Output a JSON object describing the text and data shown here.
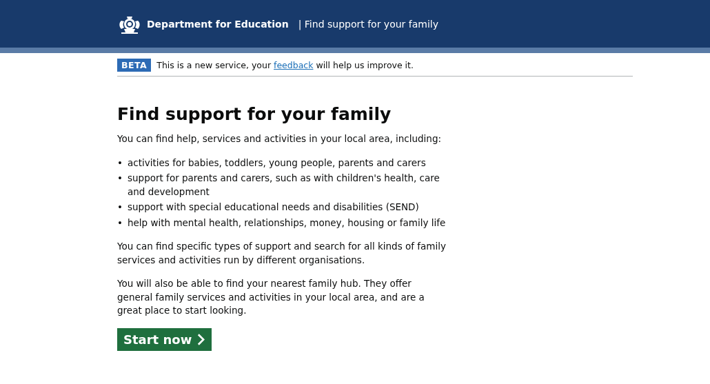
{
  "header": {
    "organisation": "Department for Education",
    "service": "| Find support for your family"
  },
  "phase_banner": {
    "tag": "BETA",
    "text_before": "This is a new service, your",
    "link": "feedback",
    "text_after": "will help us improve it."
  },
  "heading": "Find support for your family",
  "intro": "You can find help, services and activities in your local area, including:",
  "bullets": [
    {
      "marker": "•",
      "text": "activities for babies, toddlers, young people, parents and carers"
    },
    {
      "marker": "•",
      "text": "support for parents and carers, such as with children's health, care and development"
    },
    {
      "marker": "•",
      "text": "support with special educational needs and disabilities (SEND)"
    },
    {
      "marker": "•",
      "text": "help with mental health, relationships, money, housing or family life"
    }
  ],
  "paragraphs": [
    "You can find specific types of support and search for all kinds of family services and activities run by different organisations.",
    "You will also be able to find your nearest family hub. They offer general family services and activities in your local area, and are a great place to start looking."
  ],
  "button": {
    "label": "Start now"
  }
}
